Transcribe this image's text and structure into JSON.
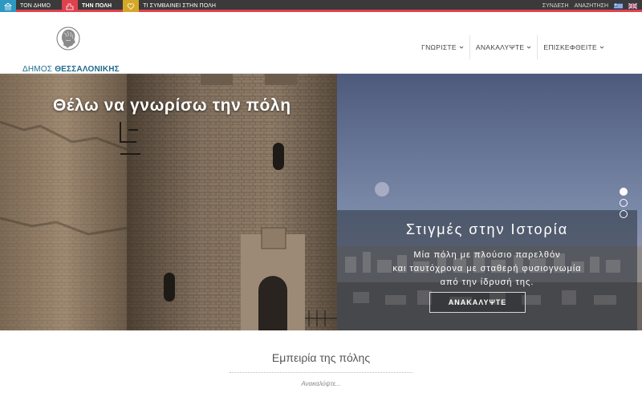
{
  "topbar": {
    "tabs": [
      {
        "label": "ΤΟΝ ΔΗΜΟ",
        "color": "#2d98c2",
        "icon": "monument-icon",
        "active": false
      },
      {
        "label": "ΤΗΝ ΠΟΛΗ",
        "color": "#e0414e",
        "icon": "city-icon",
        "active": true
      },
      {
        "label": "ΤΙ ΣΥΜΒΑΙΝΕΙ ΣΤΗΝ ΠΟΛΗ",
        "color": "#d5a728",
        "icon": "heart-icon",
        "active": false
      }
    ],
    "login": "ΣΥΝΔΕΣΗ",
    "search": "ΑΝΑΖΗΤΗΣΗ",
    "accent": "#e0414e"
  },
  "header": {
    "logo_prefix": "ΔΗΜΟΣ",
    "logo_name": "ΘΕΣΣΑΛΟΝΙΚΗΣ",
    "nav": [
      {
        "label": "ΓΝΩΡΙΣΤΕ"
      },
      {
        "label": "ΑΝΑΚΑΛΥΨΤΕ"
      },
      {
        "label": "ΕΠΙΣΚΕΦΘΕΙΤΕ"
      }
    ]
  },
  "hero": {
    "title": "Θέλω να γνωρίσω την πόλη",
    "caption_title": "Στιγμές στην Ιστορία",
    "caption_lines": [
      "Μία πόλη με πλούσιο παρελθόν",
      "και ταυτόχρονα με σταθερή φυσιογνωμία",
      "από την ίδρυσή της."
    ],
    "button": "ΑΝΑΚΑΛΥΨΤΕ",
    "slides": 3,
    "active_slide": 1
  },
  "section": {
    "heading": "Εμπειρία της πόλης",
    "subheading": "Ανακαλύψτε..."
  }
}
